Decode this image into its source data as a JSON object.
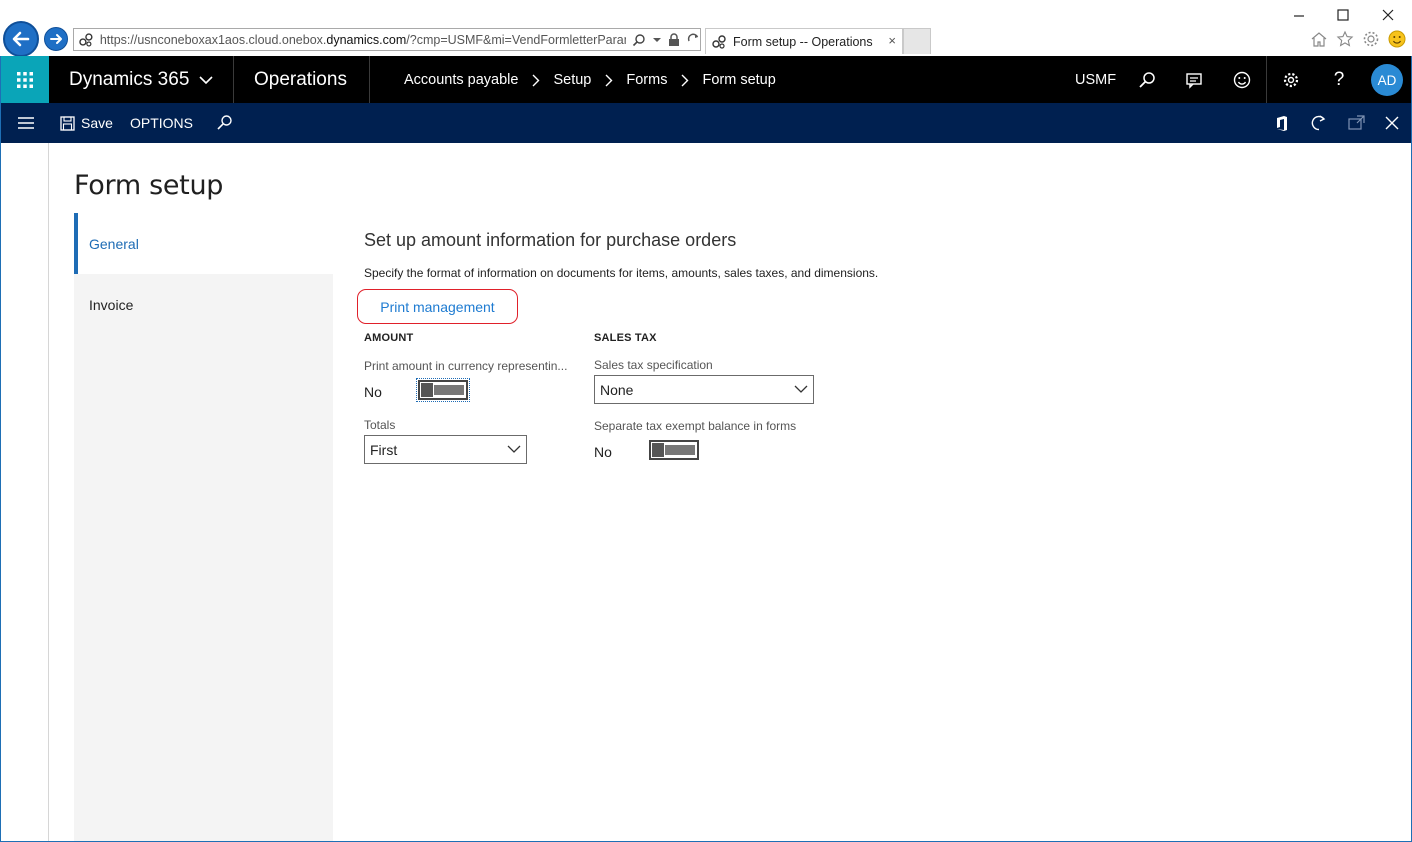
{
  "browser": {
    "url_prefix": "https://usnconeboxax1aos.cloud.onebox.",
    "url_domain": "dynamics.com",
    "url_suffix": "/?cmp=USMF&mi=VendFormletterParamete",
    "tab_title": "Form setup -- Operations",
    "tab_close": "×"
  },
  "topnav": {
    "brand": "Dynamics 365",
    "app": "Operations",
    "breadcrumb": [
      "Accounts payable",
      "Setup",
      "Forms",
      "Form setup"
    ],
    "company": "USMF",
    "avatar_initials": "AD",
    "help": "?"
  },
  "actionpane": {
    "save_label": "Save",
    "options_label": "OPTIONS"
  },
  "page": {
    "title": "Form setup",
    "tabs": [
      {
        "label": "General",
        "active": true
      },
      {
        "label": "Invoice",
        "active": false
      }
    ],
    "section_title": "Set up amount information for purchase orders",
    "section_desc": "Specify the format of information on documents for items, amounts, sales taxes, and dimensions.",
    "print_management_label": "Print management",
    "amount": {
      "group_title": "AMOUNT",
      "print_currency_label": "Print amount in currency representin...",
      "print_currency_value": "No",
      "totals_label": "Totals",
      "totals_value": "First"
    },
    "sales_tax": {
      "group_title": "SALES TAX",
      "spec_label": "Sales tax specification",
      "spec_value": "None",
      "separate_label": "Separate tax exempt balance in forms",
      "separate_value": "No"
    }
  },
  "colors": {
    "accent": "#1e6cb5",
    "waffle": "#0aa5b8",
    "actionpane": "#002050",
    "highlight": "#e0202a"
  }
}
